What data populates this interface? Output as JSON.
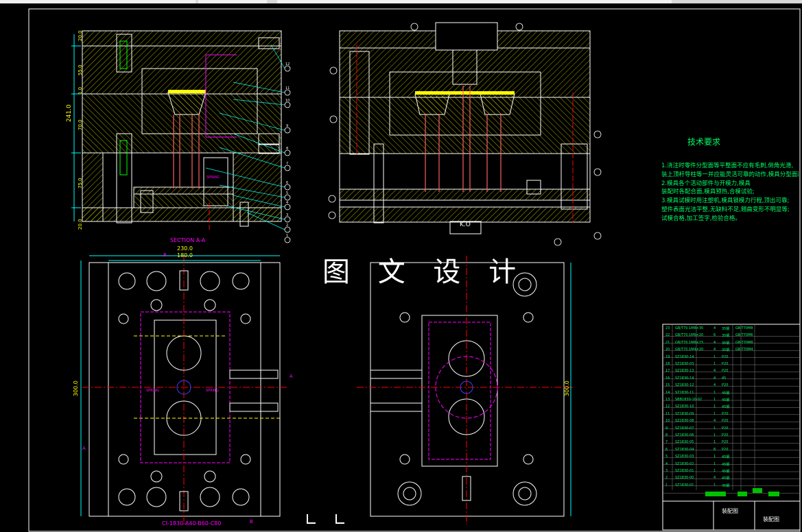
{
  "watermark": "图 文 设 计",
  "technical_requirements": {
    "title": "技术要求",
    "lines": [
      "1.浇注时零件分型面等平整面不应有毛刺,倒角光滑,",
      "装上顶杆导柱等一并应能灵活可靠的动作,模具分型面配合精度;",
      "2.模具各个活动部件与开模力,模具",
      "装配时各配合面,模具预热,合模试验;",
      "3.模具试模时用注塑机,模具锁模力行程,顶出可靠;",
      "塑件表面光洁平整,无缺料不足,翘曲变形不明显等;",
      "试模合格,加工签字,检验合格。"
    ]
  },
  "section_label": "SECTION A-A",
  "mold_base_code": "CI-1830-A40-B60-C80",
  "k_label": "K.O",
  "dimensions": {
    "total_height": "241.0",
    "d1": "20.0",
    "d2": "55.0",
    "d3": "1.0",
    "d4": "70.0",
    "d5": "75.0",
    "d6": "20.0",
    "width_overall": "230.0",
    "width_inner": "180.0",
    "height_plan": "300.0",
    "height_plan_right": "300.0"
  },
  "section_marks": {
    "a": "A",
    "b": "B"
  },
  "part_callouts": [
    "1",
    "2",
    "3",
    "4",
    "5",
    "6",
    "7",
    "8",
    "9",
    "10",
    "11",
    "12"
  ],
  "right_callouts": [
    "13",
    "14",
    "15",
    "16",
    "17",
    "18",
    "19",
    "20",
    "21",
    "22",
    "23",
    "24",
    "25"
  ],
  "labels": {
    "spring_a": "SPRING",
    "spring_b": "SPRING",
    "spring_c": "SPRING"
  },
  "title_block": {
    "drawing_title": "装配图",
    "drawing_name": "装配图"
  },
  "bom_rows": [
    {
      "no": "23",
      "name": "GB/T70.1M8×35",
      "qty": "4",
      "mat": "35钢",
      "std": "GB-T70M8"
    },
    {
      "no": "22",
      "name": "GB/T70.1M6×20",
      "qty": "6",
      "mat": "35钢",
      "std": "GB-T70M6"
    },
    {
      "no": "21",
      "name": "GB/T70.1M8×15",
      "qty": "4",
      "mat": "35钢",
      "std": "GB-T70M8"
    },
    {
      "no": "20",
      "name": "GB/T70.1M4×20",
      "qty": "4",
      "mat": "35钢",
      "std": "GB-T70M4"
    },
    {
      "no": "19",
      "name": "SZ1830-14",
      "qty": "1",
      "mat": "P20",
      "std": ""
    },
    {
      "no": "18",
      "name": "SZ1830-03",
      "qty": "1",
      "mat": "P20",
      "std": ""
    },
    {
      "no": "17",
      "name": "SZ1830-13",
      "qty": "4",
      "mat": "P20",
      "std": ""
    },
    {
      "no": "16",
      "name": "SZ1830-14",
      "qty": "4",
      "mat": "45",
      "std": ""
    },
    {
      "no": "15",
      "name": "SZ1830-12",
      "qty": "4",
      "mat": "P20",
      "std": ""
    },
    {
      "no": "14",
      "name": "SZ1830-11",
      "qty": "1",
      "mat": "45钢",
      "std": ""
    },
    {
      "no": "13",
      "name": "SBB1830-10-02",
      "qty": "1",
      "mat": "45钢",
      "std": ""
    },
    {
      "no": "12",
      "name": "SZ1830-10",
      "qty": "1",
      "mat": "45钢",
      "std": ""
    },
    {
      "no": "11",
      "name": "SZ1830-09",
      "qty": "1",
      "mat": "P20",
      "std": ""
    },
    {
      "no": "10",
      "name": "SZ1830-08",
      "qty": "4",
      "mat": "P20",
      "std": ""
    },
    {
      "no": "9",
      "name": "SZ1830-07",
      "qty": "1",
      "mat": "P20",
      "std": ""
    },
    {
      "no": "8",
      "name": "SZ1830-06",
      "qty": "1",
      "mat": "P20",
      "std": ""
    },
    {
      "no": "7",
      "name": "SZ1830-05",
      "qty": "1",
      "mat": "P20",
      "std": ""
    },
    {
      "no": "6",
      "name": "SZ1830-04",
      "qty": "8",
      "mat": "P20",
      "std": ""
    },
    {
      "no": "5",
      "name": "SZ1830-03",
      "qty": "1",
      "mat": "45钢",
      "std": ""
    },
    {
      "no": "4",
      "name": "SZ1830-02",
      "qty": "1",
      "mat": "45钢",
      "std": ""
    },
    {
      "no": "3",
      "name": "SZ1830-01",
      "qty": "1",
      "mat": "45钢",
      "std": ""
    },
    {
      "no": "2",
      "name": "SZ1830-00",
      "qty": "4",
      "mat": "45钢",
      "std": ""
    },
    {
      "no": "1",
      "name": "SZ1830-01",
      "qty": "1",
      "mat": "45钢",
      "std": ""
    }
  ],
  "colors": {
    "background": "#000000",
    "outline": "#ffffff",
    "hatch": "#ffff00",
    "dimension": "#00ffff",
    "center": "#ff0000",
    "text_green": "#00ff66",
    "magenta": "#ff00ff",
    "blue": "#4040ff"
  }
}
